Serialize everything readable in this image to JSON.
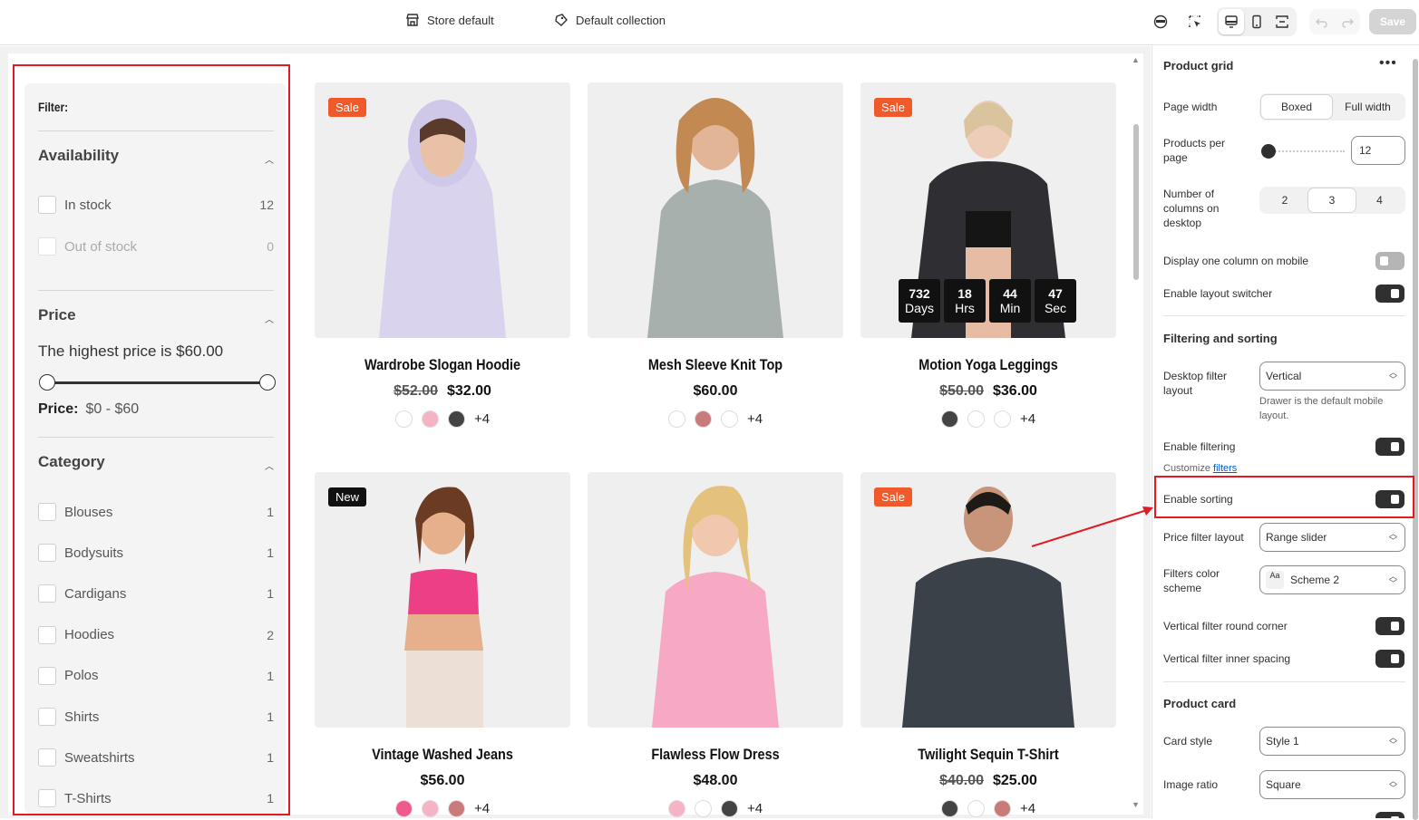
{
  "topbar": {
    "store_label": "Store default",
    "template_label": "Default collection",
    "save_label": "Save"
  },
  "filter": {
    "title": "Filter:",
    "availability": {
      "heading": "Availability",
      "items": [
        {
          "label": "In stock",
          "count": "12"
        },
        {
          "label": "Out of stock",
          "count": "0"
        }
      ]
    },
    "price": {
      "heading": "Price",
      "highest": "The highest price is $60.00",
      "range_label": "Price:",
      "range_value": "$0 - $60"
    },
    "category": {
      "heading": "Category",
      "items": [
        {
          "label": "Blouses",
          "count": "1"
        },
        {
          "label": "Bodysuits",
          "count": "1"
        },
        {
          "label": "Cardigans",
          "count": "1"
        },
        {
          "label": "Hoodies",
          "count": "2"
        },
        {
          "label": "Polos",
          "count": "1"
        },
        {
          "label": "Shirts",
          "count": "1"
        },
        {
          "label": "Sweatshirts",
          "count": "1"
        },
        {
          "label": "T-Shirts",
          "count": "1"
        }
      ]
    }
  },
  "products": [
    {
      "name": "Wardrobe Slogan Hoodie",
      "old_price": "$52.00",
      "price": "$32.00",
      "badge": "Sale",
      "more": "+4",
      "colors": [
        "#ffffff",
        "#f7b3c6",
        "#444444"
      ]
    },
    {
      "name": "Mesh Sleeve Knit Top",
      "old_price": "",
      "price": "$60.00",
      "badge": "",
      "more": "+4",
      "colors": [
        "#ffffff",
        "#c97a7a",
        "#ffffff"
      ]
    },
    {
      "name": "Motion Yoga Leggings",
      "old_price": "$50.00",
      "price": "$36.00",
      "badge": "Sale",
      "more": "+4",
      "colors": [
        "#444444",
        "#ffffff",
        "#ffffff"
      ]
    },
    {
      "name": "Vintage Washed Jeans",
      "old_price": "",
      "price": "$56.00",
      "badge": "New",
      "more": "+4",
      "colors": [
        "#f05a8a",
        "#f7b3c6",
        "#c97a7a"
      ]
    },
    {
      "name": "Flawless Flow Dress",
      "old_price": "",
      "price": "$48.00",
      "badge": "",
      "more": "+4",
      "colors": [
        "#f7b3c6",
        "#ffffff",
        "#444444"
      ]
    },
    {
      "name": "Twilight Sequin T-Shirt",
      "old_price": "$40.00",
      "price": "$25.00",
      "badge": "Sale",
      "more": "+4",
      "colors": [
        "#444444",
        "#ffffff",
        "#c97a7a"
      ]
    }
  ],
  "countdown": [
    {
      "num": "732",
      "unit": "Days"
    },
    {
      "num": "18",
      "unit": "Hrs"
    },
    {
      "num": "44",
      "unit": "Min"
    },
    {
      "num": "47",
      "unit": "Sec"
    }
  ],
  "settings": {
    "title": "Product grid",
    "page_width_label": "Page width",
    "page_width_options": [
      "Boxed",
      "Full width"
    ],
    "products_per_page_label": "Products per page",
    "products_per_page_value": "12",
    "columns_label": "Number of columns on desktop",
    "columns_options": [
      "2",
      "3",
      "4"
    ],
    "one_column_mobile_label": "Display one column on mobile",
    "layout_switcher_label": "Enable layout switcher",
    "filtering_sorting_heading": "Filtering and sorting",
    "desktop_filter_label": "Desktop filter layout",
    "desktop_filter_value": "Vertical",
    "desktop_filter_help": "Drawer is the default mobile layout.",
    "enable_filtering_label": "Enable filtering",
    "customize_text": "Customize",
    "filters_link": "filters",
    "enable_sorting_label": "Enable sorting",
    "price_filter_label": "Price filter layout",
    "price_filter_value": "Range slider",
    "filters_color_label": "Filters color scheme",
    "filters_color_value": "Scheme 2",
    "aa_icon": "Aa",
    "round_corner_label": "Vertical filter round corner",
    "inner_spacing_label": "Vertical filter inner spacing",
    "product_card_heading": "Product card",
    "card_style_label": "Card style",
    "card_style_value": "Style 1",
    "image_ratio_label": "Image ratio",
    "image_ratio_value": "Square"
  },
  "colors": {
    "annotation_red": "#e11b24",
    "sale_badge": "#f05a2a",
    "new_badge": "#111111"
  }
}
